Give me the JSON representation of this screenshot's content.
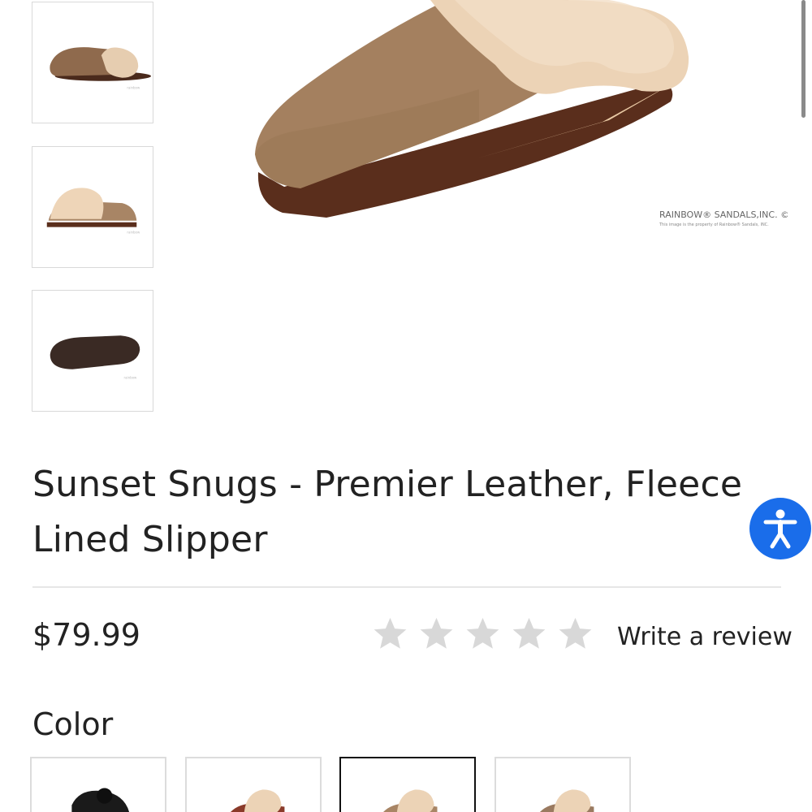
{
  "product": {
    "title_line1": "Sunset Snugs - Premier Leather, Fleece",
    "title_line2": "Lined Slipper",
    "price": "$79.99",
    "rating": 0,
    "rating_max": 5,
    "review_link": "Write a review",
    "watermark_brand": "RAINBOW® SANDALS,INC. ©",
    "watermark_note": "This image is the property of Rainbow® Sandals, INC."
  },
  "gallery": {
    "thumbnails": [
      {
        "view": "side"
      },
      {
        "view": "front-side"
      },
      {
        "view": "sole"
      }
    ]
  },
  "options": {
    "color_label": "Color",
    "swatches": [
      {
        "tone": "#1a1a1a",
        "selected": false
      },
      {
        "tone": "#8a3a2a",
        "selected": false
      },
      {
        "tone": "#a88565",
        "selected": true
      },
      {
        "tone": "#9a7a60",
        "selected": false
      }
    ]
  },
  "icons": {
    "star": "star-icon",
    "accessibility": "accessibility-icon"
  },
  "colors": {
    "star_empty": "#d8d8d8",
    "accessibility_bg": "#1a6dea",
    "leather": "#a4805f",
    "fur": "#ecd3b6",
    "sole": "#5a2e1c"
  }
}
